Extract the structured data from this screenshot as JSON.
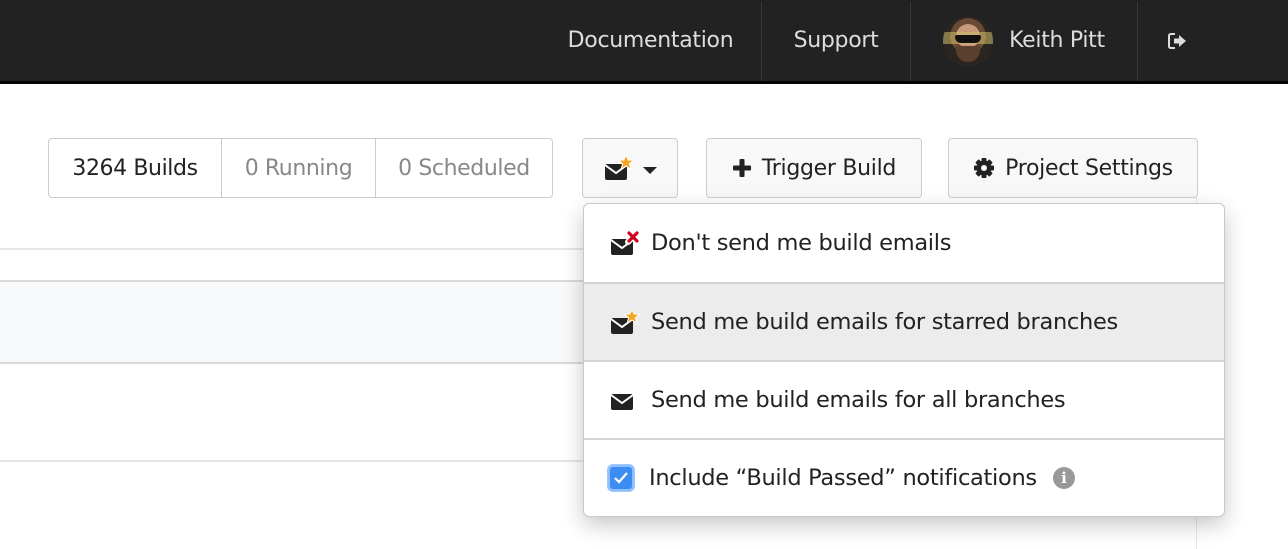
{
  "nav": {
    "documentation": "Documentation",
    "support": "Support",
    "user_name": "Keith Pitt",
    "logout_icon": "sign-out-icon"
  },
  "toolbar": {
    "builds": "3264 Builds",
    "running": "0 Running",
    "scheduled": "0 Scheduled",
    "email_button_icon": "envelope-star-icon",
    "trigger_build": "Trigger Build",
    "trigger_build_icon": "plus-icon",
    "project_settings": "Project Settings",
    "project_settings_icon": "gear-icon"
  },
  "email_dropdown": {
    "items": [
      {
        "label": "Don't send me build emails",
        "icon": "envelope-x-icon",
        "active": false
      },
      {
        "label": "Send me build emails for starred branches",
        "icon": "envelope-star-icon",
        "active": true
      },
      {
        "label": "Send me build emails for all branches",
        "icon": "envelope-icon",
        "active": false
      }
    ],
    "include_passed": {
      "label": "Include “Build Passed” notifications",
      "checked": true,
      "info_icon": "info-icon"
    }
  },
  "colors": {
    "navbar": "#222222",
    "star": "#f5a623",
    "x_mark": "#d0021b",
    "checkbox": "#3d8cf0",
    "active_item": "#ececec"
  }
}
